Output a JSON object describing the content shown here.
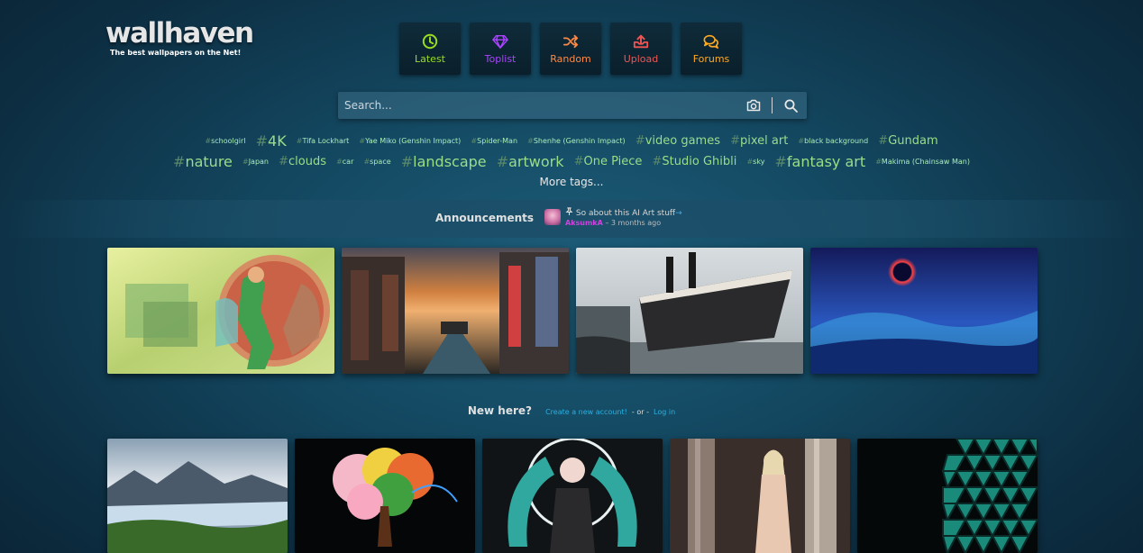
{
  "brand": {
    "name": "wallhaven",
    "tagline": "The best wallpapers on the Net!"
  },
  "nav": [
    {
      "label": "Latest",
      "icon": "clock-icon",
      "color": "#99dd22"
    },
    {
      "label": "Toplist",
      "icon": "diamond-icon",
      "color": "#aa44ff"
    },
    {
      "label": "Random",
      "icon": "shuffle-icon",
      "color": "#ff8844"
    },
    {
      "label": "Upload",
      "icon": "upload-icon",
      "color": "#ee5555"
    },
    {
      "label": "Forums",
      "icon": "chat-icon",
      "color": "#ffaa22"
    }
  ],
  "search": {
    "placeholder": "Search...",
    "camera_icon": "camera-icon",
    "search_icon": "magnifier-icon"
  },
  "tags_row1": [
    {
      "text": "schoolgirl",
      "size": "s"
    },
    {
      "text": "4K",
      "size": "l"
    },
    {
      "text": "Tifa Lockhart",
      "size": "s"
    },
    {
      "text": "Yae Miko (Genshin Impact)",
      "size": "s"
    },
    {
      "text": "Spider-Man",
      "size": "s"
    },
    {
      "text": "Shenhe (Genshin Impact)",
      "size": "s"
    },
    {
      "text": "video games",
      "size": "m"
    },
    {
      "text": "pixel art",
      "size": "m"
    },
    {
      "text": "black background",
      "size": "s"
    },
    {
      "text": "Gundam",
      "size": "m"
    }
  ],
  "tags_row2": [
    {
      "text": "nature",
      "size": "l"
    },
    {
      "text": "Japan",
      "size": "s"
    },
    {
      "text": "clouds",
      "size": "m"
    },
    {
      "text": "car",
      "size": "s"
    },
    {
      "text": "space",
      "size": "s"
    },
    {
      "text": "landscape",
      "size": "l"
    },
    {
      "text": "artwork",
      "size": "l"
    },
    {
      "text": "One Piece",
      "size": "m"
    },
    {
      "text": "Studio Ghibli",
      "size": "m"
    },
    {
      "text": "sky",
      "size": "s"
    },
    {
      "text": "fantasy art",
      "size": "l"
    },
    {
      "text": "Makima (Chainsaw Man)",
      "size": "s"
    }
  ],
  "tag_hash": "#",
  "more_tags": "More tags...",
  "announcements": {
    "title": "Announcements",
    "post_title": "So about this AI Art stuff",
    "pin_icon": "pin-icon",
    "author": "AksumkA",
    "time": "– 3 months ago"
  },
  "new_here": {
    "title": "New here?",
    "signup": "Create a new account!",
    "or": "- or -",
    "login": "Log in"
  }
}
